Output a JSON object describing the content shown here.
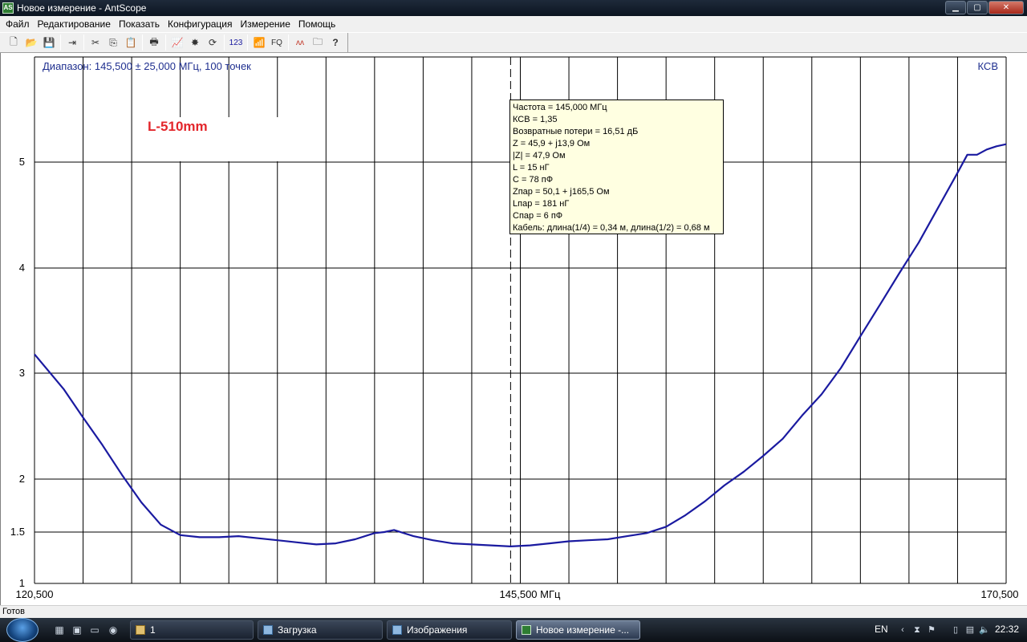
{
  "window": {
    "title": "Новое измерение - AntScope",
    "app_icon_text": "AS",
    "buttons": {
      "minimize": "▁",
      "maximize": "▢",
      "close": "✕"
    }
  },
  "menu": [
    "Файл",
    "Редактирование",
    "Показать",
    "Конфигурация",
    "Измерение",
    "Помощь"
  ],
  "toolbar": {
    "icons": [
      "new-file-icon",
      "open-folder-icon",
      "save-icon",
      "export-icon",
      "cut-icon",
      "copy-icon",
      "paste-icon",
      "print-icon",
      "chart-icon",
      "auto-scan-icon",
      "refresh-icon",
      "numbers-icon",
      "antenna-icon",
      "fq-icon",
      "analyze-icon",
      "folder-icon",
      "help-icon"
    ],
    "glyphs": [
      "🗋",
      "📂",
      "💾",
      "⇥",
      "✂",
      "⎘",
      "📋",
      "🖶",
      "📈",
      "✸",
      "⟳",
      "123",
      "📶",
      "FQ",
      "ʌʌ",
      "🗀",
      "?"
    ]
  },
  "chart_data": {
    "type": "line",
    "range_label": "Диапазон: 145,500 ± 25,000 МГц, 100 точек",
    "y_title": "КСВ",
    "note": "L-510mm",
    "x_tick_labels": [
      "120,500",
      "145,500 МГц",
      "170,500"
    ],
    "xlim": [
      120.5,
      170.5
    ],
    "y_ticks": [
      "5",
      "4",
      "3",
      "2",
      "1.5",
      "1"
    ],
    "cursor_x": 145.0,
    "series": [
      {
        "color": "#1a1aa0",
        "x": [
          120.5,
          121.5,
          122.0,
          123.0,
          124.0,
          125.0,
          126.0,
          127.0,
          128.0,
          129.0,
          130.0,
          131.0,
          132.0,
          133.0,
          134.0,
          135.0,
          136.0,
          137.0,
          138.0,
          138.5,
          139.0,
          140.0,
          141.0,
          142.0,
          143.0,
          144.0,
          145.0,
          146.0,
          147.0,
          148.0,
          149.0,
          150.0,
          151.0,
          152.0,
          153.0,
          154.0,
          155.0,
          156.0,
          157.0,
          158.0,
          159.0,
          160.0,
          161.0,
          162.0,
          163.0,
          164.0,
          165.0,
          166.0,
          167.0,
          168.0,
          168.5,
          169.0,
          169.5,
          170.0,
          170.5
        ],
        "y": [
          3.18,
          2.96,
          2.85,
          2.58,
          2.32,
          2.04,
          1.78,
          1.57,
          1.47,
          1.45,
          1.45,
          1.46,
          1.44,
          1.42,
          1.4,
          1.38,
          1.39,
          1.43,
          1.49,
          1.5,
          1.52,
          1.46,
          1.42,
          1.39,
          1.38,
          1.37,
          1.36,
          1.37,
          1.39,
          1.41,
          1.42,
          1.43,
          1.46,
          1.49,
          1.55,
          1.66,
          1.79,
          1.94,
          2.07,
          2.22,
          2.38,
          2.6,
          2.8,
          3.05,
          3.35,
          3.65,
          3.95,
          4.24,
          4.57,
          4.9,
          5.07,
          5.07,
          5.12,
          5.15,
          5.17
        ]
      }
    ]
  },
  "tooltip": {
    "lines": [
      "Частота = 145,000 МГц",
      "КСВ = 1,35",
      "Возвратные потери = 16,51 дБ",
      "Z = 45,9 + j13,9 Ом",
      "|Z| = 47,9 Ом",
      "L = 15 нГ",
      "C = 78 пФ",
      "Zпар = 50,1 + j165,5 Ом",
      "Lпар = 181 нГ",
      "Cпар = 6 пФ",
      "Кабель: длина(1/4) = 0,34 м, длина(1/2) = 0,68 м"
    ]
  },
  "status": "Готов",
  "taskbar": {
    "tasks": [
      {
        "label": "1",
        "active": false
      },
      {
        "label": "Загрузка",
        "active": false
      },
      {
        "label": "Изображения",
        "active": false
      },
      {
        "label": "Новое измерение -...",
        "active": true
      }
    ],
    "language": "EN",
    "time": "22:32"
  }
}
